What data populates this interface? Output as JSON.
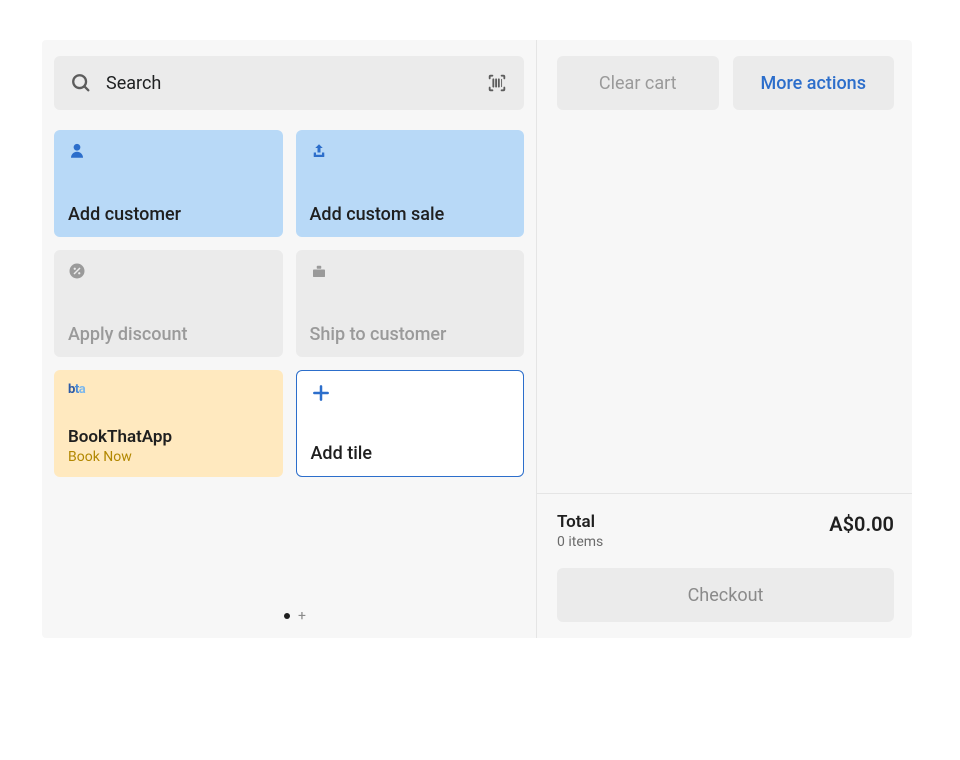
{
  "search": {
    "placeholder": "Search"
  },
  "tiles": {
    "add_customer": "Add customer",
    "add_custom_sale": "Add custom sale",
    "apply_discount": "Apply discount",
    "ship_to_customer": "Ship to customer",
    "bookthatapp": {
      "title": "BookThatApp",
      "subtitle": "Book Now"
    },
    "add_tile": "Add tile"
  },
  "actions": {
    "clear_cart": "Clear cart",
    "more_actions": "More actions"
  },
  "cart": {
    "total_label": "Total",
    "items_text": "0 items",
    "amount": "A$0.00",
    "checkout": "Checkout"
  }
}
